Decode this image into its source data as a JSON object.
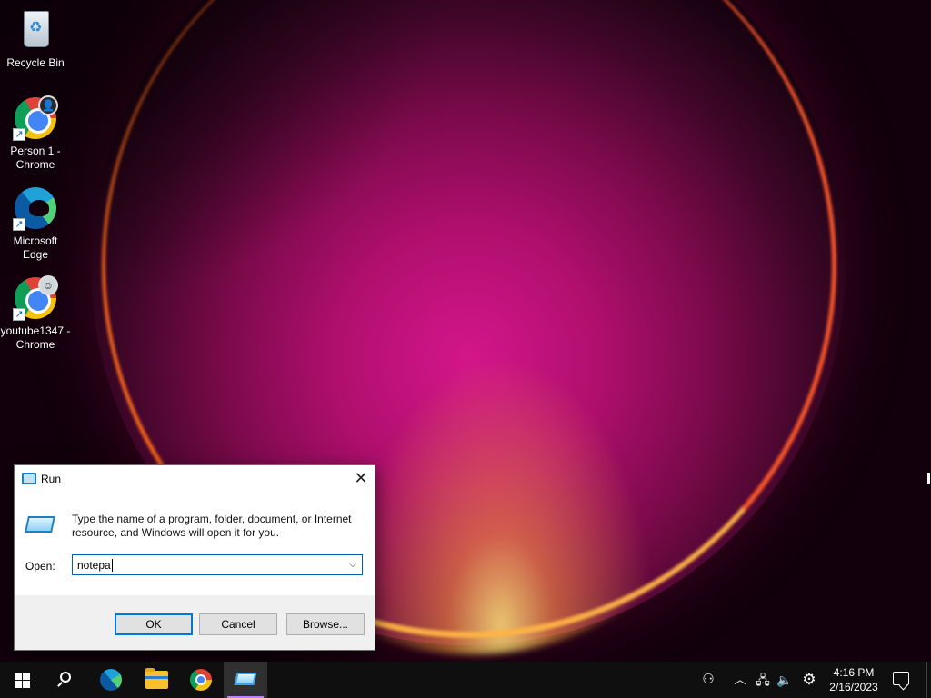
{
  "desktop": {
    "icons": [
      {
        "label": "Recycle Bin",
        "icon": "recycle-bin-icon"
      },
      {
        "label": "Person 1 - Chrome",
        "icon": "chrome-icon"
      },
      {
        "label": "Microsoft Edge",
        "icon": "edge-icon"
      },
      {
        "label": "youtube1347 - Chrome",
        "icon": "chrome-icon"
      }
    ]
  },
  "run_dialog": {
    "title": "Run",
    "close_glyph": "✕",
    "description": "Type the name of a program, folder, document, or Internet resource, and Windows will open it for you.",
    "open_label": "Open:",
    "input_value": "notepa",
    "dropdown_glyph": "⌵",
    "ok_label": "OK",
    "cancel_label": "Cancel",
    "browse_label": "Browse..."
  },
  "taskbar": {
    "pinned": [
      "start-button",
      "search-button",
      "edge",
      "file-explorer",
      "chrome",
      "run"
    ],
    "tray": {
      "people_glyph": "⚇",
      "chevron_glyph": "︿",
      "network_glyph": "🖧",
      "volume_glyph": "🔈",
      "settings_glyph": "⚙"
    },
    "time": "4:16 PM",
    "date": "2/16/2023"
  },
  "colors": {
    "accent": "#0078d7",
    "taskbar_bg": "#0f0f10",
    "active_indicator": "#c77dff"
  }
}
